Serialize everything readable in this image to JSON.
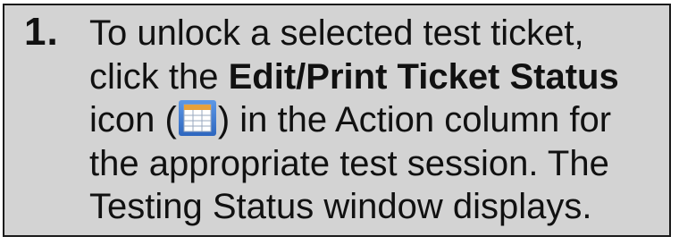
{
  "step": {
    "number": "1.",
    "line1": "To unlock a selected test ticket,",
    "line2_pre": "click the ",
    "line2_bold": "Edit/Print Ticket Status",
    "line3_pre": "icon (",
    "line3_post": ") in the Action column for",
    "line4": "the appropriate test session. The",
    "line5": "Testing Status window displays.",
    "icon": "table-grid-icon"
  },
  "colors": {
    "background": "#d3d3d3",
    "border": "#1a1a1a",
    "icon_blue": "#3a7ad2"
  }
}
